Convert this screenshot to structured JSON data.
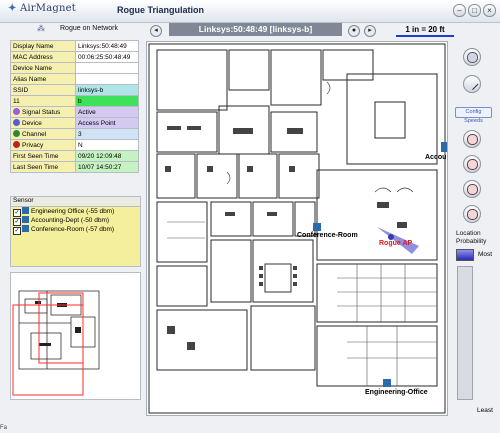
{
  "window": {
    "logo": "AirMagnet",
    "title": "Rogue Triangulation",
    "controls": [
      "–",
      "□",
      "×"
    ]
  },
  "network_label": "Rogue on Network",
  "properties": [
    {
      "key": "Display Name",
      "value": "Linksys:50:48:49",
      "key_color": "#f5f0b0",
      "value_color": "#ffffff",
      "icon": ""
    },
    {
      "key": "MAC Address",
      "value": "00:06:25:50:48:49",
      "key_color": "#f5f0b0",
      "value_color": "#ffffff",
      "icon": ""
    },
    {
      "key": "Device Name",
      "value": "",
      "key_color": "#f5f0b0",
      "value_color": "#ffffff",
      "icon": ""
    },
    {
      "key": "Alias Name",
      "value": "",
      "key_color": "#f5f0b0",
      "value_color": "#ffffff",
      "icon": ""
    },
    {
      "key": "SSID",
      "value": "linksys-b",
      "key_color": "#f5f0b0",
      "value_color": "#aee6e8",
      "icon": ""
    },
    {
      "key": "11",
      "value": "b",
      "key_color": "#f5f0b0",
      "value_color": "#3fe05a",
      "icon": ""
    },
    {
      "key": "Signal Status",
      "value": "Active",
      "key_color": "#f5f0b0",
      "value_color": "#d4c9f0",
      "icon": "signal-icon"
    },
    {
      "key": "Device",
      "value": "Access Point",
      "key_color": "#f5f0b0",
      "value_color": "#d4c9f0",
      "icon": "device-icon"
    },
    {
      "key": "Channel",
      "value": "3",
      "key_color": "#f5f0b0",
      "value_color": "#cfe2f6",
      "icon": "channel-icon"
    },
    {
      "key": "Privacy",
      "value": "N",
      "key_color": "#f5f0b0",
      "value_color": "#ffffff",
      "icon": "lock-icon"
    },
    {
      "key": "First Seen Time",
      "value": "09/20 12:09:48",
      "key_color": "#f5f0b0",
      "value_color": "#c4f2c0",
      "icon": ""
    },
    {
      "key": "Last Seen Time",
      "value": "10/07 14:50:27",
      "key_color": "#f5f0b0",
      "value_color": "#c4f2c0",
      "icon": ""
    }
  ],
  "sensor": {
    "header": "Sensor",
    "items": [
      "Engineering Office (-55 dbm)",
      "Accounting-Dept (-50 dbm)",
      "Conference-Room (-57 dbm)"
    ]
  },
  "toolbar": {
    "prev": "◂",
    "next": "▸",
    "ap_title": "Linksys:50:48:49 [linksys-b]",
    "scale": "1 in = 20 ft"
  },
  "map": {
    "labels": {
      "conference": "Conference-Room",
      "rogue": "Rogue AP",
      "accounting": "Accou",
      "engineering": "Engineering-Office"
    },
    "rogue_color": "#d81e1e"
  },
  "tools": {
    "config_label": "Config Speeds"
  },
  "legend": {
    "title": "Location Probability",
    "most": "Most",
    "least": "Least"
  },
  "status_text": "Fa"
}
